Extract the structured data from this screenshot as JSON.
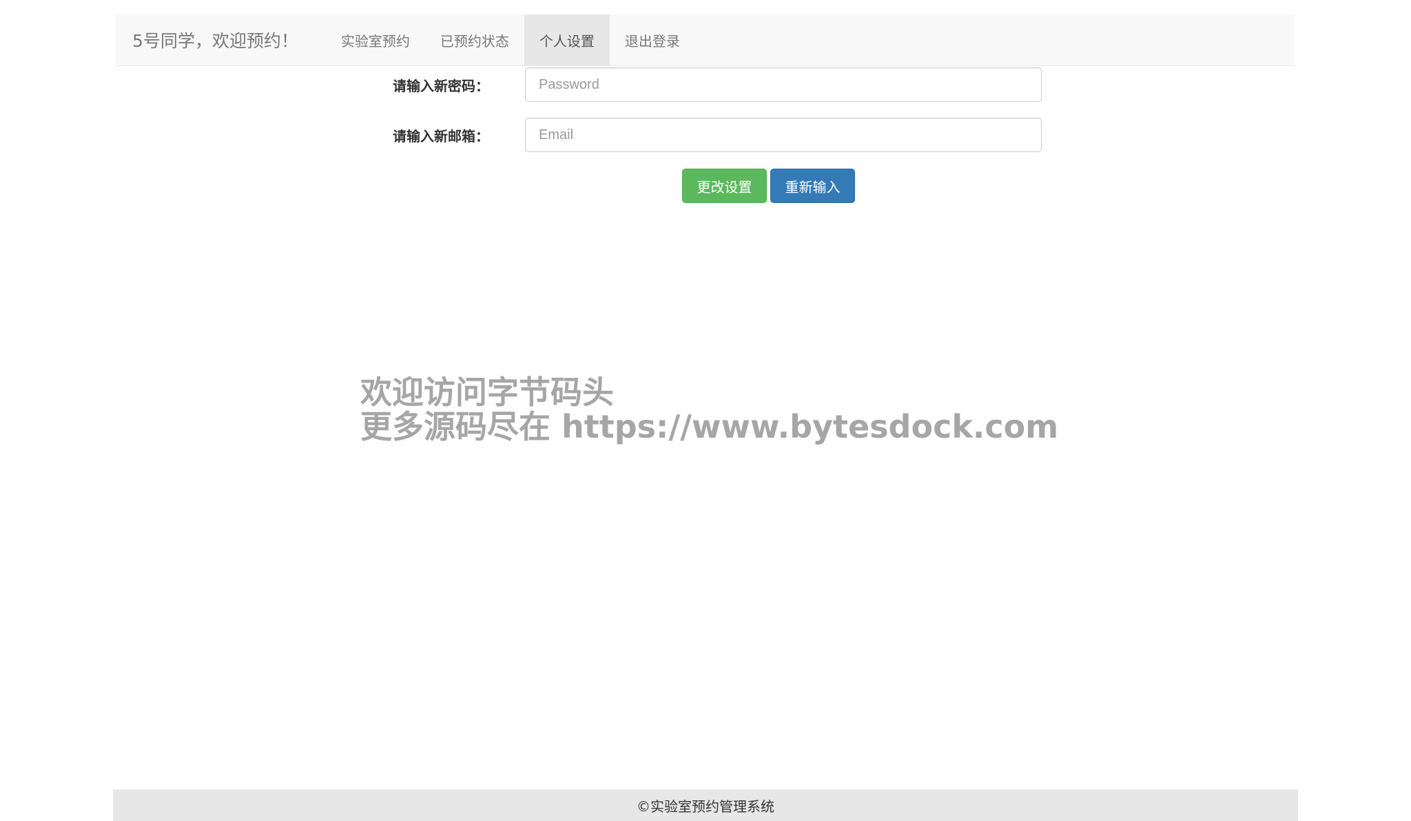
{
  "navbar": {
    "brand": "5号同学，欢迎预约！",
    "items": [
      {
        "label": "实验室预约",
        "active": false
      },
      {
        "label": "已预约状态",
        "active": false
      },
      {
        "label": "个人设置",
        "active": true
      },
      {
        "label": "退出登录",
        "active": false
      }
    ]
  },
  "form": {
    "password_label": "请输入新密码：",
    "password_placeholder": "Password",
    "password_value": "",
    "email_label": "请输入新邮箱：",
    "email_placeholder": "Email",
    "email_value": "",
    "submit_label": "更改设置",
    "reset_label": "重新输入"
  },
  "watermark": {
    "line1": "欢迎访问字节码头",
    "line2": "更多源码尽在  https://www.bytesdock.com"
  },
  "footer": {
    "text": "©实验室预约管理系统"
  },
  "colors": {
    "success": "#5cb85c",
    "primary": "#337ab7",
    "navbar_bg": "#f8f8f8",
    "footer_bg": "#e7e7e7"
  }
}
